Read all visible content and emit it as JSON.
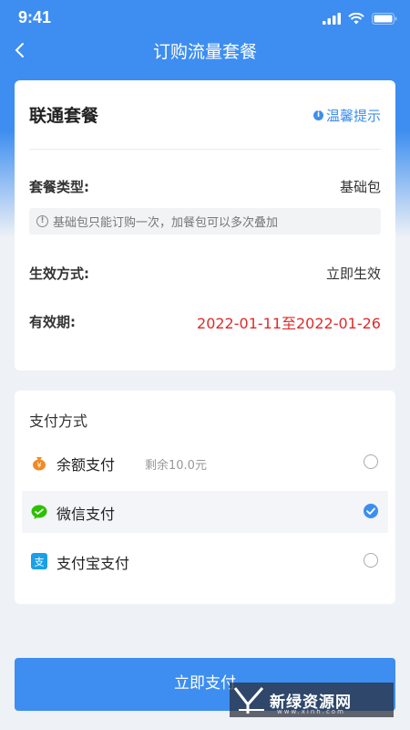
{
  "status_bar": {
    "time": "9:41"
  },
  "nav": {
    "title": "订购流量套餐"
  },
  "plan": {
    "title": "联通套餐",
    "tip_label": "温馨提示",
    "type_label": "套餐类型:",
    "type_value": "基础包",
    "notice": "基础包只能订购一次，加餐包可以多次叠加",
    "effect_label": "生效方式:",
    "effect_value": "立即生效",
    "validity_label": "有效期:",
    "validity_value": "2022-01-11至2022-01-26"
  },
  "payment": {
    "title": "支付方式",
    "options": [
      {
        "label": "余额支付",
        "sub": "剩余10.0元",
        "icon": "money-bag-icon",
        "selected": false
      },
      {
        "label": "微信支付",
        "sub": "",
        "icon": "wechat-icon",
        "selected": true
      },
      {
        "label": "支付宝支付",
        "sub": "",
        "icon": "alipay-icon",
        "selected": false
      }
    ]
  },
  "action": {
    "pay_button": "立即支付"
  },
  "watermark": {
    "text": "新绿资源网",
    "sub": "www.xinh.com"
  },
  "colors": {
    "accent": "#3d8ef0",
    "date_red": "#e02a2a",
    "wechat": "#2dc100",
    "alipay": "#1a9fe8",
    "balance": "#f08a24"
  }
}
